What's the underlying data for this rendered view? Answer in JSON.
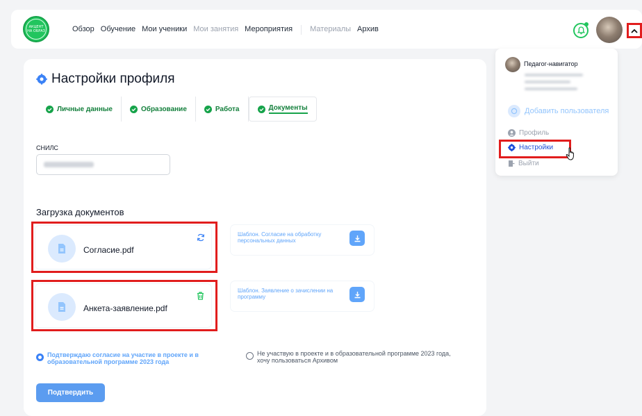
{
  "header": {
    "logo_text": "АКЦЕНТ НА ОБРАЗ",
    "nav": [
      {
        "label": "Обзор",
        "muted": false
      },
      {
        "label": "Обучение",
        "muted": false
      },
      {
        "label": "Мои ученики",
        "muted": false
      },
      {
        "label": "Мои занятия",
        "muted": true
      },
      {
        "label": "Мероприятия",
        "muted": false
      },
      {
        "label": "Материалы",
        "muted": true
      },
      {
        "label": "Архив",
        "muted": false
      }
    ]
  },
  "page": {
    "title": "Настройки профиля",
    "tabs": [
      {
        "label": "Личные данные"
      },
      {
        "label": "Образование"
      },
      {
        "label": "Работа"
      },
      {
        "label": "Документы",
        "active": true
      }
    ],
    "snils_label": "СНИЛС",
    "upload_title": "Загрузка документов",
    "documents": [
      {
        "name": "Согласие.pdf",
        "action_icon": "refresh-icon"
      },
      {
        "name": "Анкета-заявление.pdf",
        "action_icon": "trash-icon"
      }
    ],
    "templates": [
      {
        "text": "Шаблон. Согласие на обработку персональных данных"
      },
      {
        "text": "Шаблон. Заявление о зачислении на программу"
      }
    ],
    "radio_yes": "Подтверждаю согласие на участие в проекте и в образовательной программе 2023 года",
    "radio_no": "Не участвую в проекте и в образовательной программе 2023 года, хочу пользоваться Архивом",
    "confirm_label": "Подтвердить"
  },
  "dropdown": {
    "role": "Педагог-навигатор",
    "add_user": "Добавить пользователя",
    "profile": "Профиль",
    "settings": "Настройки",
    "logout": "Выйти"
  },
  "colors": {
    "accent_green": "#16a34a",
    "accent_blue": "#3b82f6",
    "highlight_red": "#e11d1d"
  }
}
